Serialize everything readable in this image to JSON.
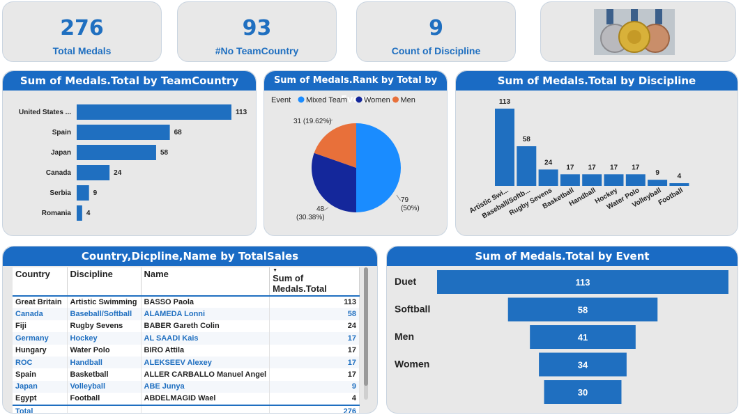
{
  "kpis": [
    {
      "value": "276",
      "label": "Total Medals"
    },
    {
      "value": "93",
      "label": "#No TeamCountry"
    },
    {
      "value": "9",
      "label": "Count of Discipline"
    }
  ],
  "image_alt": "medals-image",
  "country_chart": {
    "title": "Sum of Medals.Total by TeamCountry",
    "chart_data": {
      "type": "bar",
      "orientation": "horizontal",
      "categories": [
        "United States ...",
        "Spain",
        "Japan",
        "Canada",
        "Serbia",
        "Romania"
      ],
      "values": [
        113,
        68,
        58,
        24,
        9,
        4
      ],
      "color": "#1f6fc0"
    }
  },
  "pie_chart": {
    "title": "Sum of Medals.Rank by Total by Event",
    "legend_title": "Event",
    "chart_data": {
      "type": "pie",
      "slices": [
        {
          "name": "Mixed Team",
          "value": 79,
          "pct": "50%",
          "color": "#1a8cff"
        },
        {
          "name": "Women",
          "value": 48,
          "pct": "30.38%",
          "color": "#14279b"
        },
        {
          "name": "Men",
          "value": 31,
          "pct": "19.62%",
          "color": "#e8703a"
        }
      ]
    },
    "labels": {
      "mixed_value": "79",
      "mixed_pct": "(50%)",
      "women_value": "48",
      "women_pct": "(30.38%)",
      "men_label": "31 (19.62%)"
    }
  },
  "discipline_chart": {
    "title": "Sum of Medals.Total by Discipline",
    "chart_data": {
      "type": "bar",
      "categories": [
        "Artistic Swi...",
        "Baseball/Softb...",
        "Rugby Sevens",
        "Basketball",
        "Handball",
        "Hockey",
        "Water Polo",
        "Volleyball",
        "Football"
      ],
      "values": [
        113,
        58,
        24,
        17,
        17,
        17,
        17,
        9,
        4
      ],
      "color": "#1f6fc0"
    }
  },
  "table": {
    "title": "Country,Dicpline,Name by TotalSales",
    "columns": [
      "Country",
      "Discipline",
      "Name",
      "Sum of Medals.Total"
    ],
    "rows": [
      [
        "Great Britain",
        "Artistic Swimming",
        "BASSO Paola",
        "113"
      ],
      [
        "Canada",
        "Baseball/Softball",
        "ALAMEDA Lonni",
        "58"
      ],
      [
        "Fiji",
        "Rugby Sevens",
        "BABER Gareth Colin",
        "24"
      ],
      [
        "Germany",
        "Hockey",
        "AL SAADI Kais",
        "17"
      ],
      [
        "Hungary",
        "Water Polo",
        "BIRO Attila",
        "17"
      ],
      [
        "ROC",
        "Handball",
        "ALEKSEEV Alexey",
        "17"
      ],
      [
        "Spain",
        "Basketball",
        "ALLER CARBALLO Manuel Angel",
        "17"
      ],
      [
        "Japan",
        "Volleyball",
        "ABE Junya",
        "9"
      ],
      [
        "Egypt",
        "Football",
        "ABDELMAGID Wael",
        "4"
      ]
    ],
    "total_label": "Total",
    "total_value": "276"
  },
  "funnel_chart": {
    "title": "Sum of Medals.Total by Event",
    "chart_data": {
      "type": "bar",
      "subtype": "funnel",
      "categories": [
        "Duet",
        "Softball",
        "Men",
        "Women",
        ""
      ],
      "values": [
        113,
        58,
        41,
        34,
        30
      ],
      "color": "#1f6fc0"
    }
  }
}
